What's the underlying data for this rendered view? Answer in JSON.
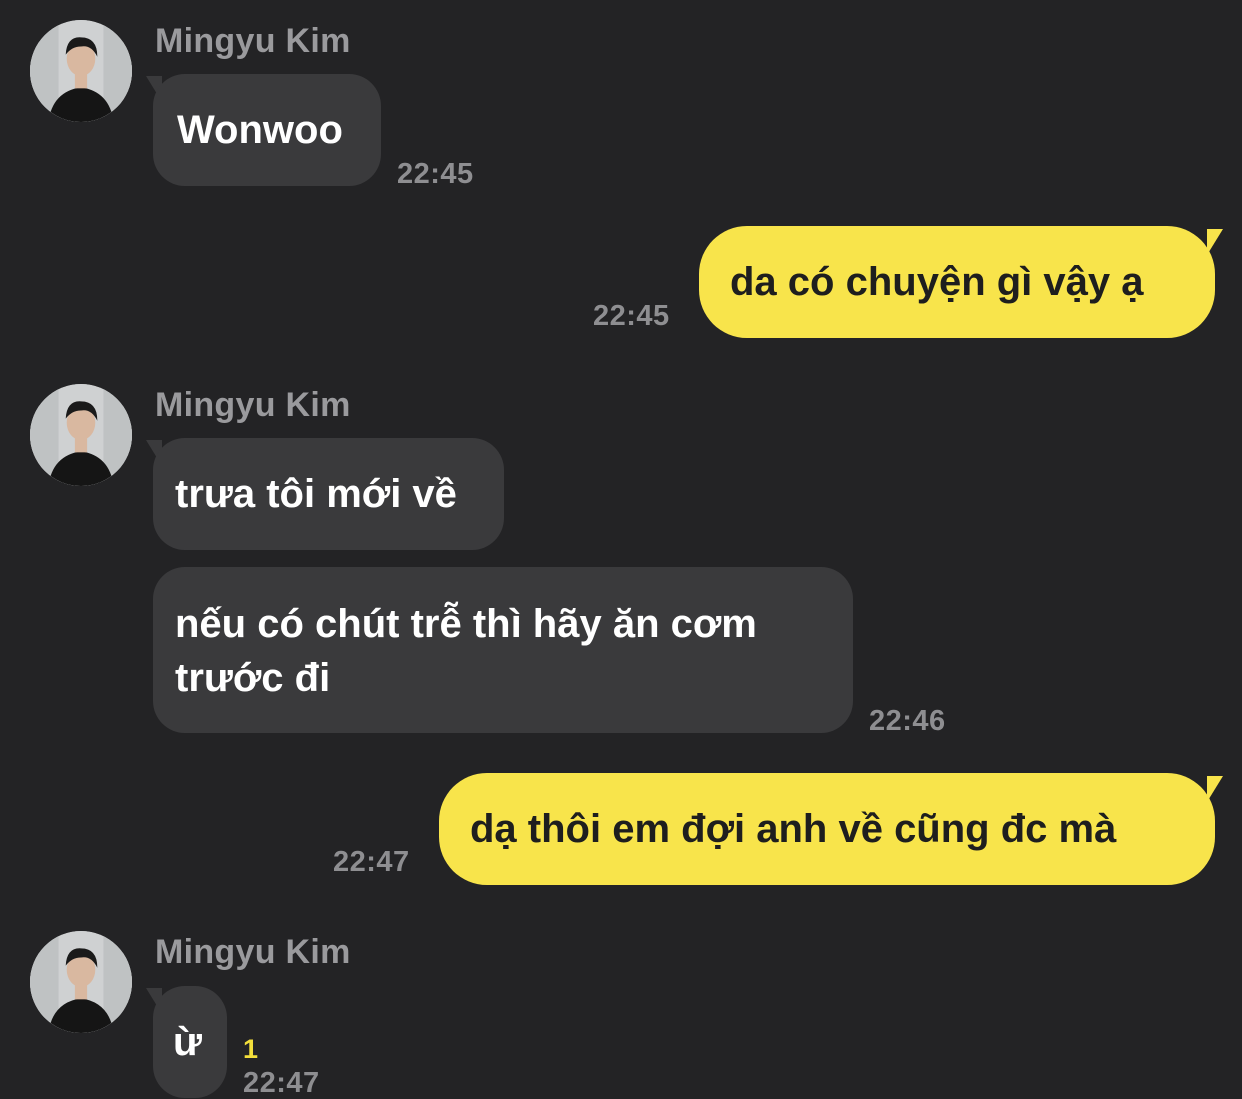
{
  "messages": [
    {
      "sender": "Mingyu Kim",
      "text": "Wonwoo",
      "time": "22:45"
    },
    {
      "text": "da có chuyện gì vậy ạ",
      "time": "22:45"
    },
    {
      "sender": "Mingyu Kim",
      "text": "trưa tôi mới về"
    },
    {
      "text_line1": "nếu có chút trễ thì hãy ăn cơm",
      "text_line2": "trước đi",
      "time": "22:46"
    },
    {
      "text": "dạ thôi em đợi anh về cũng đc mà",
      "time": "22:47"
    },
    {
      "sender": "Mingyu Kim",
      "text": "ừ",
      "unread": "1",
      "time": "22:47"
    }
  ],
  "colors": {
    "background": "#232325",
    "incoming_bubble": "#3a3a3c",
    "outgoing_bubble": "#f8e44b",
    "unread_badge": "#f2de3b"
  }
}
